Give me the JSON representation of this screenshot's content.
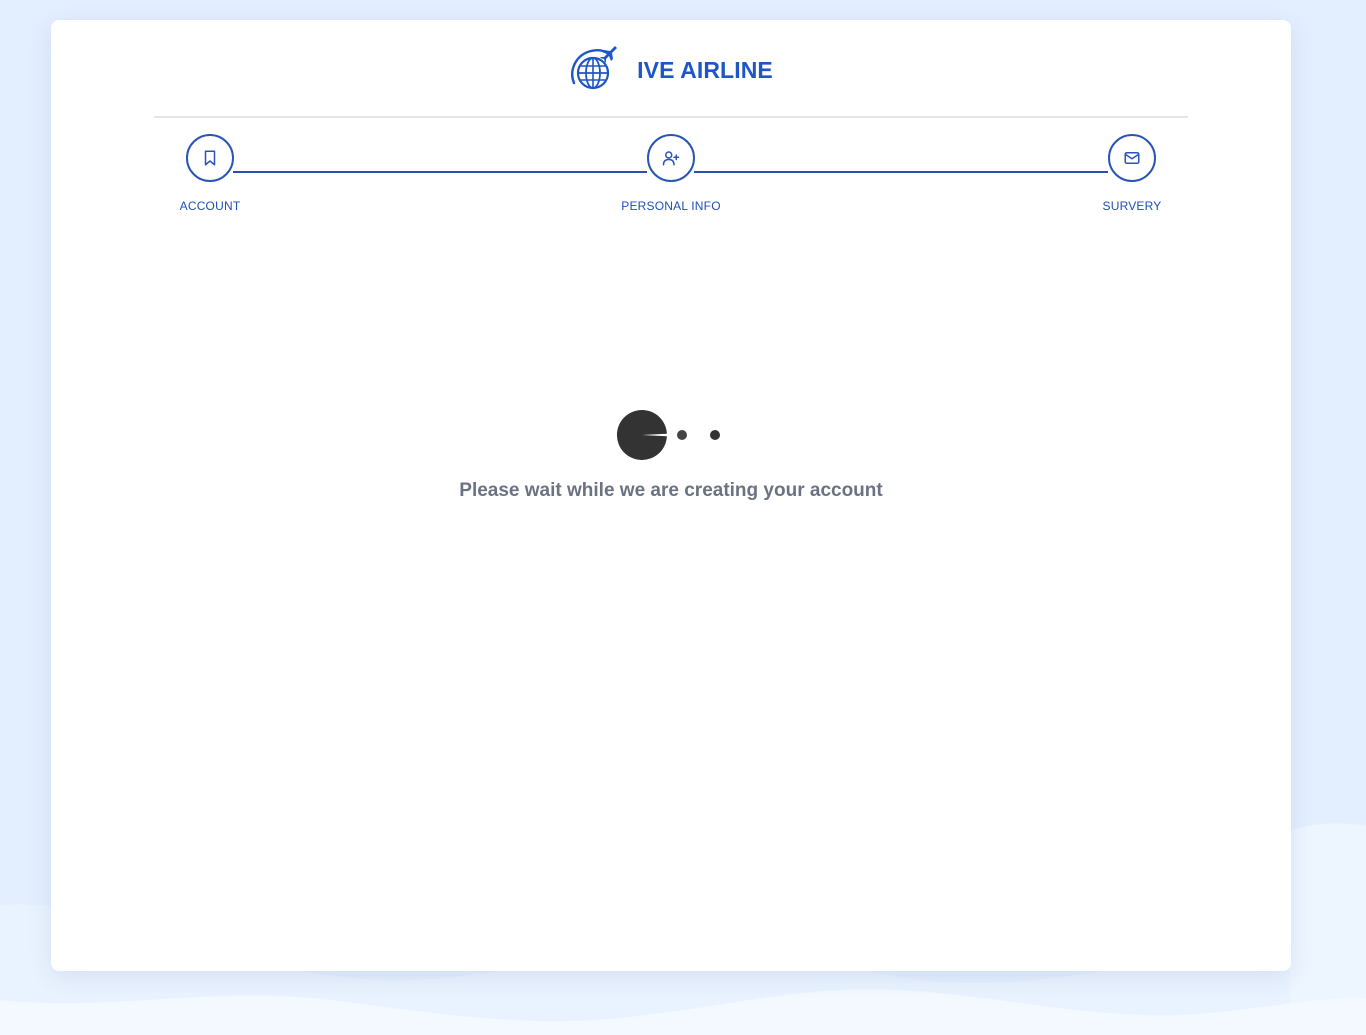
{
  "brand": {
    "name": "IVE AIRLINE",
    "logo_icon": "globe-airplane-icon"
  },
  "stepper": {
    "steps": [
      {
        "label": "ACCOUNT",
        "icon": "bookmark-icon"
      },
      {
        "label": "PERSONAL INFO",
        "icon": "user-plus-icon"
      },
      {
        "label": "SURVERY",
        "icon": "mail-icon"
      }
    ]
  },
  "loading": {
    "message": "Please wait while we are creating your account",
    "animation_icon": "pacman-loader-icon"
  },
  "colors": {
    "brand_blue": "#1f56c7",
    "step_border": "#2b54b8",
    "background": "#e3efff",
    "loader": "#333333",
    "message_text": "#6b7383"
  }
}
